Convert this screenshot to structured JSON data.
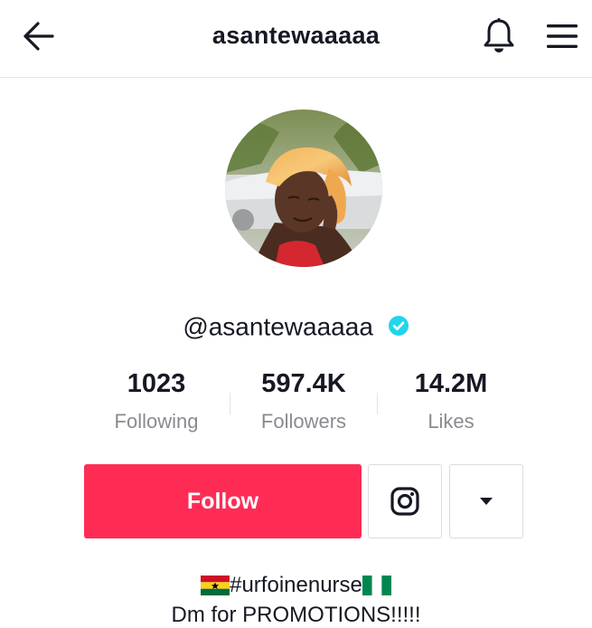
{
  "header": {
    "title": "asantewaaaaa",
    "back_icon": "arrow-left-icon",
    "bell_icon": "bell-icon",
    "menu_icon": "hamburger-menu-icon"
  },
  "profile": {
    "handle": "@asantewaaaaa",
    "verified": true,
    "verified_icon": "verified-check-icon",
    "avatar": "profile-photo"
  },
  "stats": [
    {
      "value": "1023",
      "label": "Following"
    },
    {
      "value": "597.4K",
      "label": "Followers"
    },
    {
      "value": "14.2M",
      "label": "Likes"
    }
  ],
  "actions": {
    "follow_label": "Follow",
    "instagram_icon": "instagram-icon",
    "dropdown_icon": "caret-down-icon"
  },
  "bio": {
    "line1_flag_left": "ghana-flag",
    "line1_text": "#urfoinenurse",
    "line1_flag_right": "nigeria-flag",
    "line2": "Dm for PROMOTIONS!!!!!"
  },
  "colors": {
    "accent": "#fe2c55",
    "verified": "#20d5ec",
    "text": "#161823",
    "muted": "#8a8b91"
  }
}
